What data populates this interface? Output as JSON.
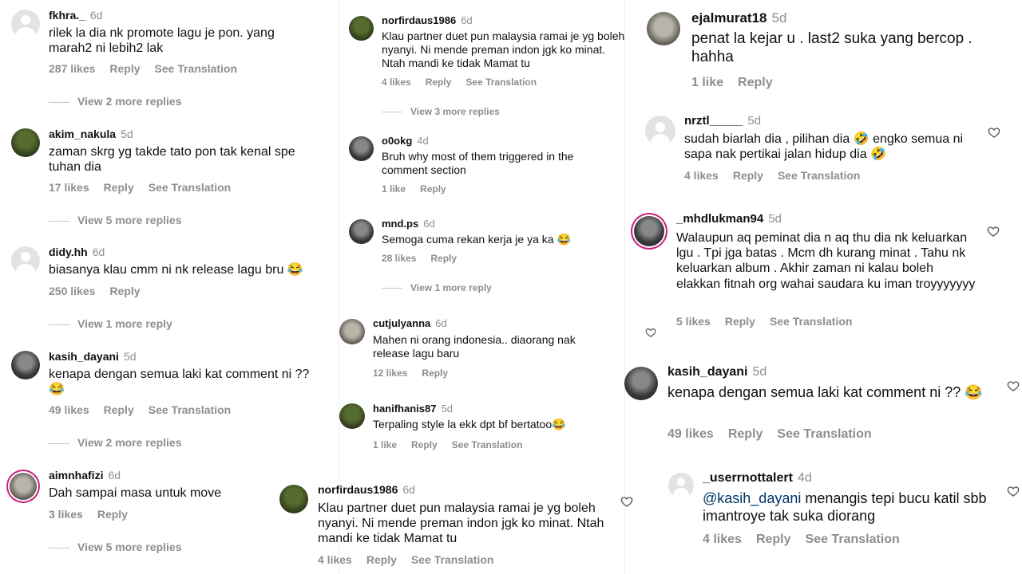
{
  "col1": [
    {
      "user": "fkhra._",
      "time": "6d",
      "text": "rilek la dia nk promote lagu je pon. yang marah2 ni lebih2 lak",
      "likes": "287 likes",
      "reply": "Reply",
      "translate": "See Translation",
      "more": "View 2 more replies"
    },
    {
      "user": "akim_nakula",
      "time": "5d",
      "text": "zaman skrg yg takde tato pon tak kenal spe tuhan dia",
      "likes": "17 likes",
      "reply": "Reply",
      "translate": "See Translation",
      "more": "View 5 more replies"
    },
    {
      "user": "didy.hh",
      "time": "6d",
      "text": "biasanya klau cmm ni nk release lagu bru 😂",
      "likes": "250 likes",
      "reply": "Reply",
      "translate": "",
      "more": "View 1 more reply"
    },
    {
      "user": "kasih_dayani",
      "time": "5d",
      "text": "kenapa dengan semua laki kat comment ni ?? 😂",
      "likes": "49 likes",
      "reply": "Reply",
      "translate": "See Translation",
      "more": "View 2 more replies"
    },
    {
      "user": "aimnhafizi",
      "time": "6d",
      "text": "Dah sampai masa untuk move",
      "likes": "3 likes",
      "reply": "Reply",
      "translate": "",
      "more": "View 5 more replies"
    }
  ],
  "col2": [
    {
      "user": "norfirdaus1986",
      "time": "6d",
      "text": "Klau partner duet pun malaysia ramai je yg boleh nyanyi. Ni mende preman indon jgk ko minat. Ntah mandi ke tidak Mamat tu",
      "likes": "4 likes",
      "reply": "Reply",
      "translate": "See Translation",
      "more": "View 3 more replies"
    },
    {
      "user": "o0okg",
      "time": "4d",
      "text": "Bruh why most of them triggered in the comment section",
      "likes": "1 like",
      "reply": "Reply",
      "translate": "",
      "more": ""
    },
    {
      "user": "mnd.ps",
      "time": "6d",
      "text": "Semoga cuma rekan kerja je ya ka 😂",
      "likes": "28 likes",
      "reply": "Reply",
      "translate": "",
      "more": "View 1 more reply"
    },
    {
      "user": "cutjulyanna",
      "time": "6d",
      "text": "Mahen ni orang indonesia.. diaorang nak release lagu baru",
      "likes": "12 likes",
      "reply": "Reply",
      "translate": "",
      "more": ""
    },
    {
      "user": "hanifhanis87",
      "time": "5d",
      "text": "Terpaling style la ekk dpt bf bertatoo😂",
      "likes": "1 like",
      "reply": "Reply",
      "translate": "See Translation",
      "more": ""
    },
    {
      "user": "norfirdaus1986",
      "time": "6d",
      "text": "Klau partner duet pun malaysia ramai je yg boleh nyanyi. Ni mende preman indon jgk ko minat. Ntah mandi ke tidak Mamat tu",
      "likes": "4 likes",
      "reply": "Reply",
      "translate": "See Translation",
      "more": ""
    }
  ],
  "col3": [
    {
      "user": "ejalmurat18",
      "time": "5d",
      "text": "penat la kejar  u . last2 suka yang bercop . hahha",
      "likes": "1 like",
      "reply": "Reply",
      "translate": ""
    },
    {
      "user": "nrztl_____",
      "time": "5d",
      "text": "sudah biarlah dia , pilihan dia 🤣 engko semua ni sapa nak pertikai jalan hidup dia 🤣",
      "likes": "4 likes",
      "reply": "Reply",
      "translate": "See Translation"
    },
    {
      "user": "_mhdlukman94",
      "time": "5d",
      "text": "Walaupun aq peminat dia n aq thu dia nk keluarkan lgu . Tpi jga batas . Mcm dh kurang minat . Tahu nk keluarkan album . Akhir zaman ni kalau boleh elakkan fitnah org wahai saudara ku iman troyyyyyyy",
      "likes": "5 likes",
      "reply": "Reply",
      "translate": "See Translation"
    },
    {
      "user": "kasih_dayani",
      "time": "5d",
      "text": "kenapa dengan semua laki kat comment ni ?? 😂",
      "likes": "49 likes",
      "reply": "Reply",
      "translate": "See Translation"
    },
    {
      "user": "_userrnottalert",
      "time": "4d",
      "mention": "@kasih_dayani",
      "text": " menangis tepi bucu katil sbb imantroye tak suka diorang",
      "likes": "4 likes",
      "reply": "Reply",
      "translate": "See Translation"
    }
  ]
}
